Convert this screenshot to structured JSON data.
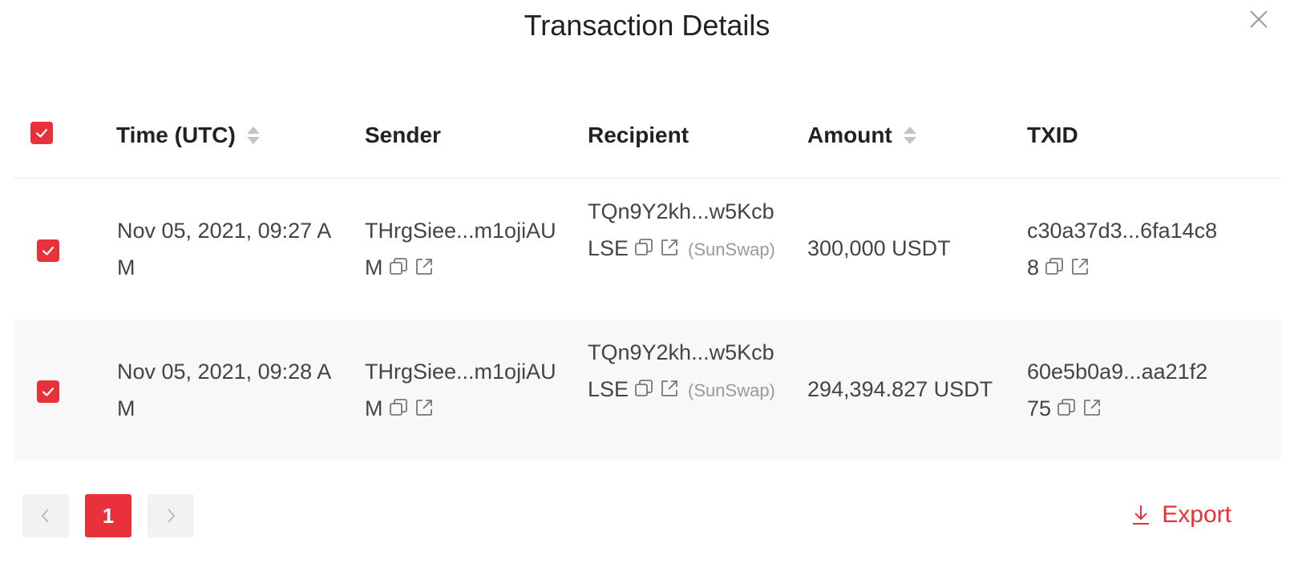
{
  "modal": {
    "title": "Transaction Details"
  },
  "colors": {
    "accent": "#e8313a",
    "row_alt_bg": "#f8f8f8"
  },
  "table": {
    "select_all_checked": true,
    "columns": [
      {
        "key": "time",
        "label": "Time (UTC)",
        "sortable": true
      },
      {
        "key": "sender",
        "label": "Sender",
        "sortable": false
      },
      {
        "key": "recipient",
        "label": "Recipient",
        "sortable": false
      },
      {
        "key": "amount",
        "label": "Amount",
        "sortable": true
      },
      {
        "key": "txid",
        "label": "TXID",
        "sortable": false
      }
    ],
    "rows": [
      {
        "checked": true,
        "time": "Nov 05, 2021, 09:27 AM",
        "sender": "THrgSiee...m1ojiAUM",
        "recipient": "TQn9Y2kh...w5KcbLSE",
        "recipient_tag": "(SunSwap)",
        "amount": "300,000 USDT",
        "txid": "c30a37d3...6fa14c88"
      },
      {
        "checked": true,
        "time": "Nov 05, 2021, 09:28 AM",
        "sender": "THrgSiee...m1ojiAUM",
        "recipient": "TQn9Y2kh...w5KcbLSE",
        "recipient_tag": "(SunSwap)",
        "amount": "294,394.827 USDT",
        "txid": "60e5b0a9...aa21f275"
      }
    ]
  },
  "pagination": {
    "current_page": "1"
  },
  "actions": {
    "export_label": "Export"
  },
  "icons": {
    "close": "close-icon",
    "sort": "sort-icon",
    "copy": "copy-icon",
    "external": "external-link-icon",
    "download": "download-icon",
    "prev": "chevron-left-icon",
    "next": "chevron-right-icon",
    "check": "checkmark-icon"
  }
}
